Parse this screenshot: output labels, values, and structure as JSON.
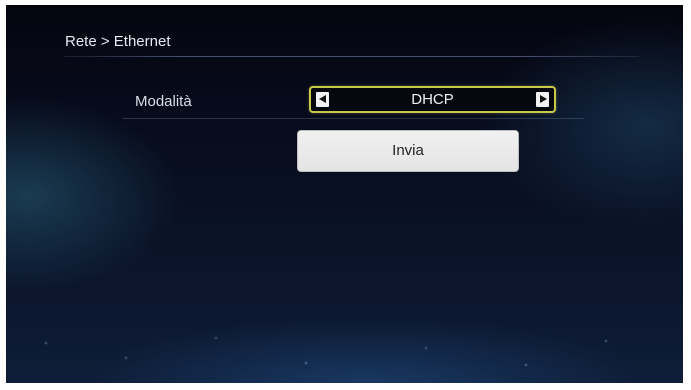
{
  "header": {
    "breadcrumb": "Rete > Ethernet"
  },
  "settings": {
    "mode": {
      "label": "Modalità",
      "value": "DHCP",
      "prev_icon": "arrow-left-icon",
      "next_icon": "arrow-right-icon"
    }
  },
  "actions": {
    "submit_label": "Invia"
  },
  "colors": {
    "focus_border": "#c8c84a",
    "background": "#070b1c",
    "button_bg": "#e9e9e9"
  }
}
